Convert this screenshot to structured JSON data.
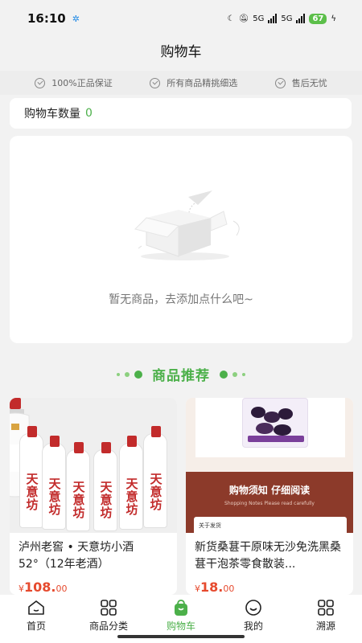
{
  "status_bar": {
    "time": "16:10",
    "network1": "5G",
    "network2": "5G",
    "battery": "67"
  },
  "header": {
    "title": "购物车"
  },
  "guarantees": [
    {
      "label": "100%正品保证",
      "icon": "check-circle-icon"
    },
    {
      "label": "所有商品精挑细选",
      "icon": "check-circle-icon"
    },
    {
      "label": "售后无忧",
      "icon": "check-circle-icon"
    }
  ],
  "cart": {
    "count_label": "购物车数量",
    "count": "0",
    "empty_text": "暂无商品，去添加点什么吧~"
  },
  "recommend": {
    "title": "商品推荐"
  },
  "products": [
    {
      "name": "泸州老窖 • 天意坊小酒52°（12年老酒）",
      "price_symbol": "¥",
      "price": "108.",
      "price_tail": "00",
      "bottle_label": "天意坊"
    },
    {
      "name": "新货桑葚干原味无沙免洗黑桑葚干泡茶零食散装...",
      "price_symbol": "¥",
      "price": "18.",
      "price_tail": "00",
      "banner_title": "购物须知 仔细阅读",
      "banner_subtitle": "Shopping Notes Please read carefully",
      "banner_tag": "关于发货"
    }
  ],
  "tabs": [
    {
      "label": "首页",
      "icon": "home-icon"
    },
    {
      "label": "商品分类",
      "icon": "category-grid-icon"
    },
    {
      "label": "购物车",
      "icon": "shopping-bag-icon"
    },
    {
      "label": "我的",
      "icon": "smiley-profile-icon"
    },
    {
      "label": "溯源",
      "icon": "trace-grid-icon"
    }
  ],
  "colors": {
    "accent": "#4cb04a",
    "price": "#e64a2e",
    "banner": "#8c3a2a"
  }
}
